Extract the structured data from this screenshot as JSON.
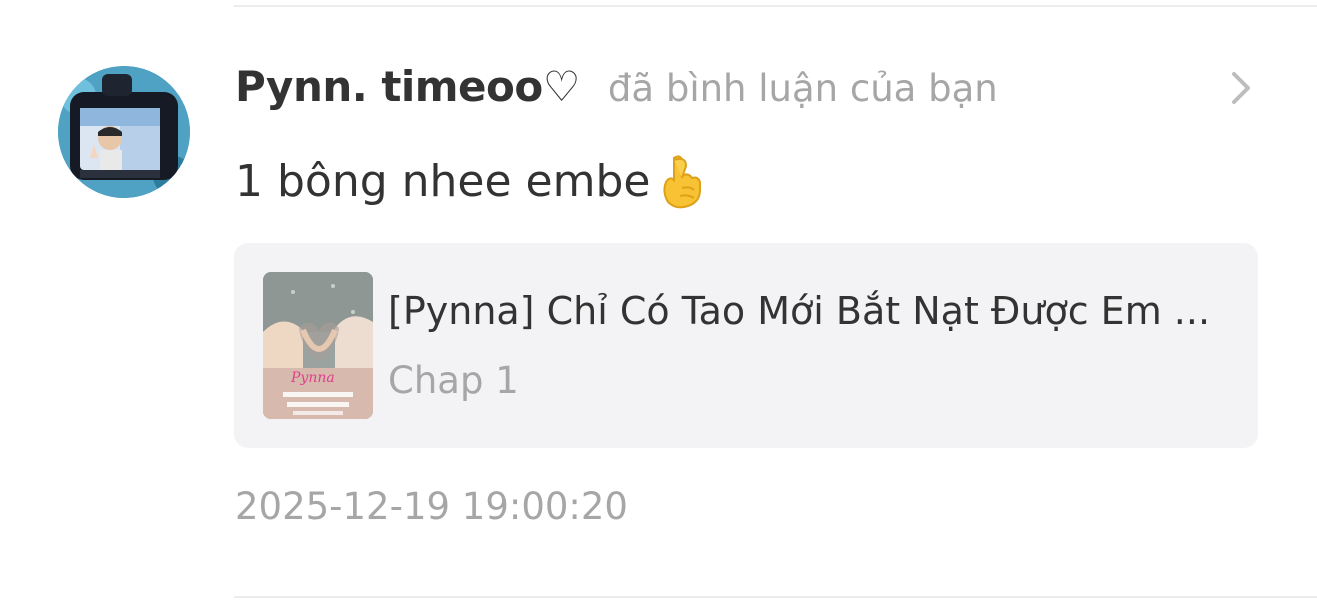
{
  "notification": {
    "username": "Pynn. timeoo♡",
    "action_text": "đã bình luận của bạn",
    "comment_text": "1 bông nhee embe",
    "comment_emoji": "crossed-fingers-emoji",
    "timestamp": "2025-12-19 19:00:20"
  },
  "story": {
    "title": "[Pynna] Chỉ Có Tao Mới Bắt Nạt Được Em ...",
    "chapter": "Chap 1",
    "cover_caption": "Pynna"
  },
  "colors": {
    "username": "#333333",
    "secondary_text": "#a6a6a6",
    "card_background": "#f3f3f5",
    "divider": "#ececec"
  },
  "icons": {
    "chevron": "chevron-right-icon",
    "avatar": "user-avatar",
    "cover": "story-cover-image"
  }
}
